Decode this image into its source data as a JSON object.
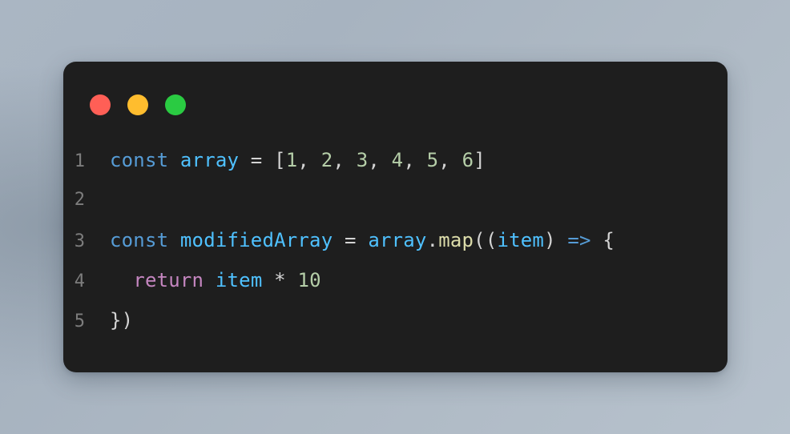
{
  "window": {
    "kind": "code-snippet-window",
    "background_color": "#1e1e1e",
    "corner_radius_px": 16,
    "traffic_lights": [
      {
        "name": "close-dot",
        "label": "close",
        "color": "#ff5f56"
      },
      {
        "name": "minimize-dot",
        "label": "minimize",
        "color": "#ffbd2e"
      },
      {
        "name": "maximize-dot",
        "label": "maximize",
        "color": "#2acb42"
      }
    ]
  },
  "page": {
    "background_from": "#aab6c3",
    "background_to": "#b7c2cd"
  },
  "editor": {
    "language": "javascript",
    "line_number_color": "#7d7d7d",
    "default_text_color": "#d4d4d4",
    "syntax_colors": {
      "keyword": "#569cd6",
      "variable": "#4fc1ff",
      "function": "#dcdcaa",
      "number": "#b5cea8",
      "control": "#c586c0",
      "punctuation": "#d4d4d4"
    },
    "lines": [
      {
        "number": "1",
        "text": "const array = [1, 2, 3, 4, 5, 6]",
        "tokens": [
          {
            "t": "const",
            "c": "keyword"
          },
          {
            "t": " ",
            "c": "punctuation"
          },
          {
            "t": "array",
            "c": "variable"
          },
          {
            "t": " = [",
            "c": "punctuation"
          },
          {
            "t": "1",
            "c": "number"
          },
          {
            "t": ", ",
            "c": "punctuation"
          },
          {
            "t": "2",
            "c": "number"
          },
          {
            "t": ", ",
            "c": "punctuation"
          },
          {
            "t": "3",
            "c": "number"
          },
          {
            "t": ", ",
            "c": "punctuation"
          },
          {
            "t": "4",
            "c": "number"
          },
          {
            "t": ", ",
            "c": "punctuation"
          },
          {
            "t": "5",
            "c": "number"
          },
          {
            "t": ", ",
            "c": "punctuation"
          },
          {
            "t": "6",
            "c": "number"
          },
          {
            "t": "]",
            "c": "punctuation"
          }
        ]
      },
      {
        "number": "2",
        "text": "",
        "tokens": []
      },
      {
        "number": "3",
        "text": "const modifiedArray = array.map((item) => {",
        "tokens": [
          {
            "t": "const",
            "c": "keyword"
          },
          {
            "t": " ",
            "c": "punctuation"
          },
          {
            "t": "modifiedArray",
            "c": "variable"
          },
          {
            "t": " = ",
            "c": "punctuation"
          },
          {
            "t": "array",
            "c": "variable"
          },
          {
            "t": ".",
            "c": "punctuation"
          },
          {
            "t": "map",
            "c": "function"
          },
          {
            "t": "((",
            "c": "punctuation"
          },
          {
            "t": "item",
            "c": "variable"
          },
          {
            "t": ") ",
            "c": "punctuation"
          },
          {
            "t": "=>",
            "c": "keyword"
          },
          {
            "t": " {",
            "c": "punctuation"
          }
        ]
      },
      {
        "number": "4",
        "text": "  return item * 10",
        "tokens": [
          {
            "t": "  ",
            "c": "punctuation"
          },
          {
            "t": "return",
            "c": "control"
          },
          {
            "t": " ",
            "c": "punctuation"
          },
          {
            "t": "item",
            "c": "variable"
          },
          {
            "t": " * ",
            "c": "punctuation"
          },
          {
            "t": "10",
            "c": "number"
          }
        ]
      },
      {
        "number": "5",
        "text": "})",
        "tokens": [
          {
            "t": "})",
            "c": "punctuation"
          }
        ]
      }
    ]
  }
}
